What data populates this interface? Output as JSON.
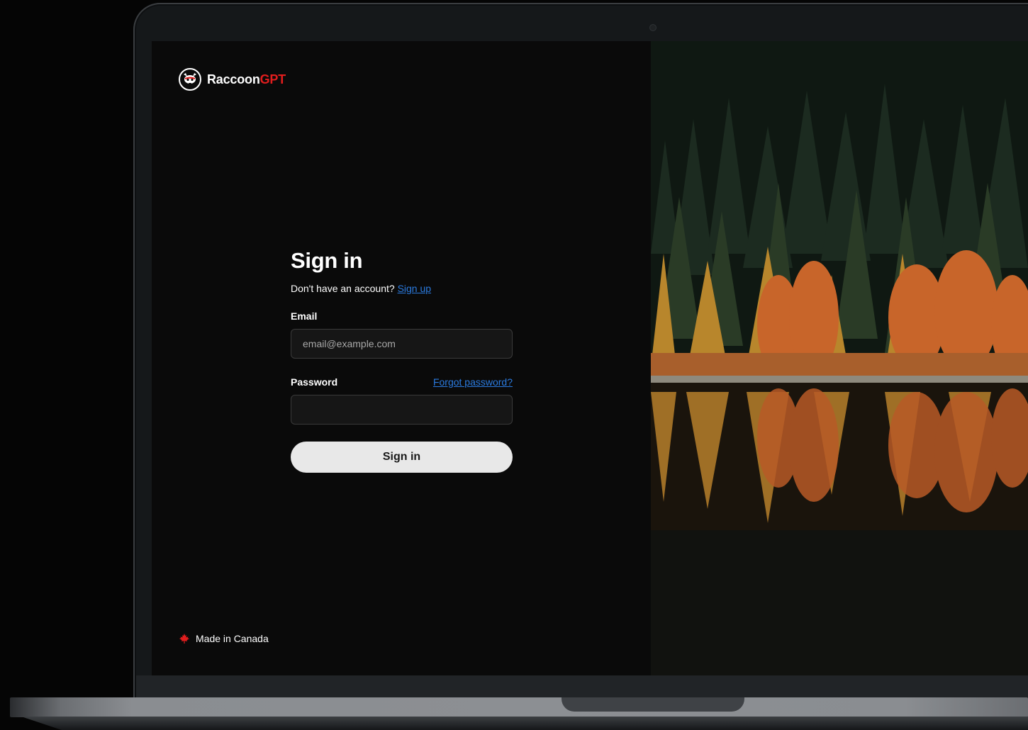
{
  "brand": {
    "name_main": "Raccoon",
    "name_accent": "GPT",
    "accent_color": "#e11d1d",
    "logo_icon": "raccoon-icon"
  },
  "signin": {
    "title": "Sign in",
    "subtitle_prefix": "Don't have an account?",
    "signup_link": "Sign up",
    "email_label": "Email",
    "email_placeholder": "email@example.com",
    "password_label": "Password",
    "forgot_link": "Forgot password?",
    "submit_label": "Sign in"
  },
  "footer": {
    "text": "Made in Canada",
    "icon": "maple-leaf-icon",
    "icon_color": "#e11d1d"
  },
  "photo": {
    "subject": "autumn-forest-lake-reflection"
  }
}
